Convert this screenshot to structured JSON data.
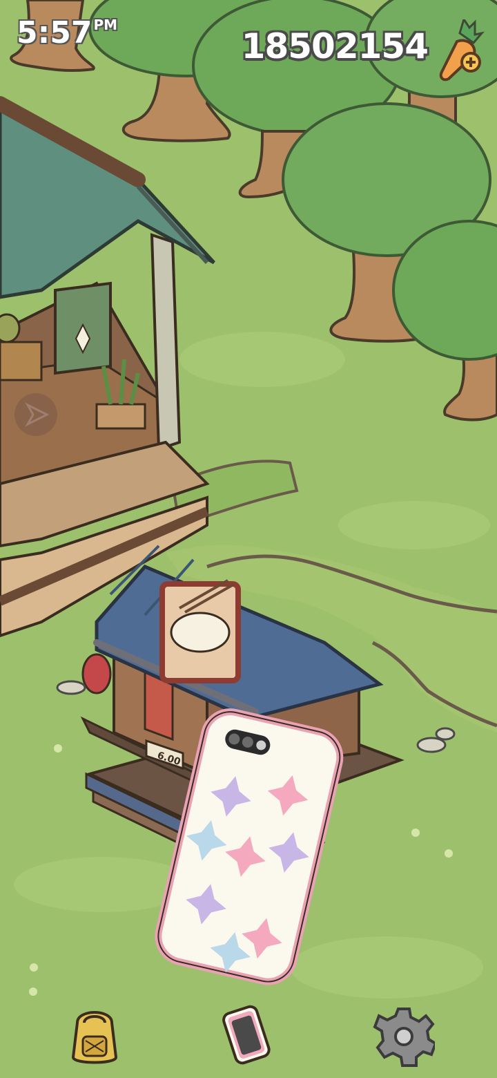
{
  "hud": {
    "time": "5:57",
    "ampm": "PM",
    "carrot_count": "18502154"
  },
  "scene": {
    "stand_sign": "6.00"
  },
  "icons": {
    "carrot_add": "carrot-plus-icon",
    "side_play": "play-triangle-icon",
    "backpack": "backpack-icon",
    "phone": "phone-icon",
    "settings": "gear-icon"
  },
  "colors": {
    "grass": "#9cc06b",
    "tree_foliage": "#6ea95a",
    "bark": "#b98a5e",
    "house_roof": "#5f8f7f",
    "stand_roof": "#4f6d94",
    "phone_case": "#fbf8ee",
    "phone_case_edge": "#e9a1b4"
  }
}
